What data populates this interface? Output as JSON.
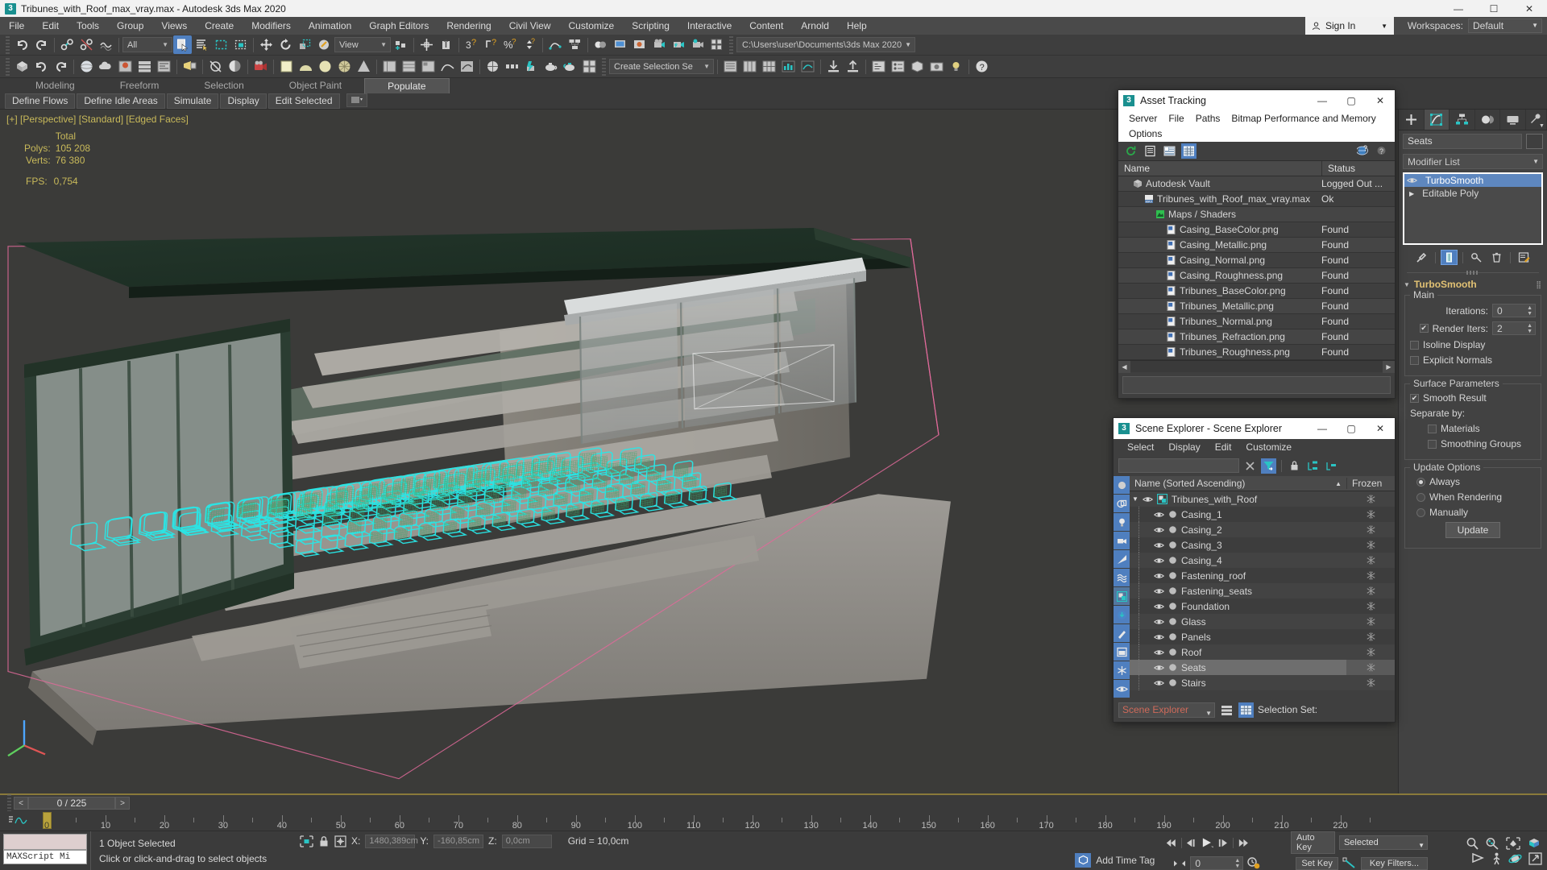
{
  "titlebar": {
    "icon": "max-logo-icon",
    "title": "Tribunes_with_Roof_max_vray.max - Autodesk 3ds Max 2020",
    "minimize": "—",
    "maximize": "☐",
    "close": "✕"
  },
  "menubar": {
    "items": [
      "File",
      "Edit",
      "Tools",
      "Group",
      "Views",
      "Create",
      "Modifiers",
      "Animation",
      "Graph Editors",
      "Rendering",
      "Civil View",
      "Customize",
      "Scripting",
      "Interactive",
      "Content",
      "Arnold",
      "Help"
    ],
    "signin": "Sign In",
    "workspaces_label": "Workspaces:",
    "workspace_value": "Default"
  },
  "toolbar": {
    "selection_filter": "All",
    "reference_coord": "View",
    "selection_set_placeholder": "Create Selection Se",
    "project_path": "C:\\Users\\user\\Documents\\3ds Max 2020"
  },
  "ribbon": {
    "tabs": [
      "Modeling",
      "Freeform",
      "Selection",
      "Object Paint",
      "Populate"
    ],
    "active_tab": "Populate",
    "panels": [
      "Define Flows",
      "Define Idle Areas",
      "Simulate",
      "Display",
      "Edit Selected"
    ]
  },
  "viewport": {
    "label": "[+] [Perspective] [Standard] [Edged Faces]",
    "stats_header": "Total",
    "stats": [
      {
        "label": "Polys:",
        "value": "105 208"
      },
      {
        "label": "Verts:",
        "value": "76 380"
      }
    ],
    "fps_label": "FPS:",
    "fps_value": "0,754"
  },
  "asset_tracking": {
    "title": "Asset Tracking",
    "menu": [
      "Server",
      "File",
      "Paths",
      "Bitmap Performance and Memory",
      "Options"
    ],
    "toolbar_icons": [
      "refresh-icon",
      "list-view-icon",
      "detail-view-icon",
      "grid-view-icon",
      "help-globe-icon",
      "help-alt-icon"
    ],
    "columns": [
      "Name",
      "Status"
    ],
    "rows": [
      {
        "name": "Autodesk Vault",
        "status": "Logged Out ...",
        "indent": 1,
        "icon": "vault-icon"
      },
      {
        "name": "Tribunes_with_Roof_max_vray.max",
        "status": "Ok",
        "indent": 2,
        "icon": "max-file-icon"
      },
      {
        "name": "Maps / Shaders",
        "status": "",
        "indent": 3,
        "icon": "maps-icon"
      },
      {
        "name": "Casing_BaseColor.png",
        "status": "Found",
        "indent": 4,
        "icon": "image-file-icon"
      },
      {
        "name": "Casing_Metallic.png",
        "status": "Found",
        "indent": 4,
        "icon": "image-file-icon"
      },
      {
        "name": "Casing_Normal.png",
        "status": "Found",
        "indent": 4,
        "icon": "image-file-icon"
      },
      {
        "name": "Casing_Roughness.png",
        "status": "Found",
        "indent": 4,
        "icon": "image-file-icon"
      },
      {
        "name": "Tribunes_BaseColor.png",
        "status": "Found",
        "indent": 4,
        "icon": "image-file-icon"
      },
      {
        "name": "Tribunes_Metallic.png",
        "status": "Found",
        "indent": 4,
        "icon": "image-file-icon"
      },
      {
        "name": "Tribunes_Normal.png",
        "status": "Found",
        "indent": 4,
        "icon": "image-file-icon"
      },
      {
        "name": "Tribunes_Refraction.png",
        "status": "Found",
        "indent": 4,
        "icon": "image-file-icon"
      },
      {
        "name": "Tribunes_Roughness.png",
        "status": "Found",
        "indent": 4,
        "icon": "image-file-icon"
      }
    ]
  },
  "scene_explorer": {
    "title": "Scene Explorer - Scene Explorer",
    "menu": [
      "Select",
      "Display",
      "Edit",
      "Customize"
    ],
    "search_value": "",
    "columns": [
      "Name (Sorted Ascending)",
      "Frozen"
    ],
    "rows": [
      {
        "name": "Tribunes_with_Roof",
        "level": 0,
        "selected": false,
        "group": true
      },
      {
        "name": "Casing_1",
        "level": 1,
        "selected": false
      },
      {
        "name": "Casing_2",
        "level": 1,
        "selected": false
      },
      {
        "name": "Casing_3",
        "level": 1,
        "selected": false
      },
      {
        "name": "Casing_4",
        "level": 1,
        "selected": false
      },
      {
        "name": "Fastening_roof",
        "level": 1,
        "selected": false
      },
      {
        "name": "Fastening_seats",
        "level": 1,
        "selected": false
      },
      {
        "name": "Foundation",
        "level": 1,
        "selected": false
      },
      {
        "name": "Glass",
        "level": 1,
        "selected": false
      },
      {
        "name": "Panels",
        "level": 1,
        "selected": false
      },
      {
        "name": "Roof",
        "level": 1,
        "selected": false
      },
      {
        "name": "Seats",
        "level": 1,
        "selected": true
      },
      {
        "name": "Stairs",
        "level": 1,
        "selected": false
      }
    ],
    "explorer_combo": "Scene Explorer",
    "selection_set_label": "Selection Set:"
  },
  "command_panel": {
    "object_name": "Seats",
    "modifier_list_label": "Modifier List",
    "stack": [
      {
        "name": "TurboSmooth",
        "selected": true
      },
      {
        "name": "Editable Poly",
        "selected": false
      }
    ],
    "rollout_title": "TurboSmooth",
    "main_group": "Main",
    "iterations_label": "Iterations:",
    "iterations_value": "0",
    "render_iters_label": "Render Iters:",
    "render_iters_value": "2",
    "render_iters_checked": true,
    "isoline_label": "Isoline Display",
    "isoline_checked": false,
    "explicit_normals_label": "Explicit Normals",
    "explicit_normals_checked": false,
    "surface_group": "Surface Parameters",
    "smooth_result_label": "Smooth Result",
    "smooth_result_checked": true,
    "separate_by_label": "Separate by:",
    "materials_label": "Materials",
    "materials_checked": false,
    "smoothing_groups_label": "Smoothing Groups",
    "smoothing_groups_checked": false,
    "update_group": "Update Options",
    "update_options": [
      "Always",
      "When Rendering",
      "Manually"
    ],
    "update_selected": "Always",
    "update_button": "Update"
  },
  "timeline": {
    "prev_label": "<",
    "next_label": ">",
    "frame_display": "0 / 225",
    "ticks": [
      0,
      10,
      20,
      30,
      40,
      50,
      60,
      70,
      80,
      90,
      100,
      110,
      120,
      130,
      140,
      150,
      160,
      170,
      180,
      190,
      200,
      210,
      220
    ],
    "slider_frame": 0,
    "max_frame": 225
  },
  "statusbar": {
    "maxscript_label": "MAXScript Mi",
    "selection_status": "1 Object Selected",
    "prompt": "Click or click-and-drag to select objects",
    "x_label": "X:",
    "x_value": "1480,389cm",
    "y_label": "Y:",
    "y_value": "-160,85cm",
    "z_label": "Z:",
    "z_value": "0,0cm",
    "grid": "Grid = 10,0cm",
    "add_time_tag": "Add Time Tag",
    "auto_key": "Auto Key",
    "set_key": "Set Key",
    "key_mode_value": "Selected",
    "key_filters": "Key Filters...",
    "key_num": "0"
  },
  "colors": {
    "accent_blue": "#4f7fbf",
    "teal": "#2ac4c4",
    "yellow_text": "#c8b95a",
    "selection_cyan": "#28e0e0",
    "panel_bg": "#424242",
    "window_bg": "#3f3f3f"
  }
}
